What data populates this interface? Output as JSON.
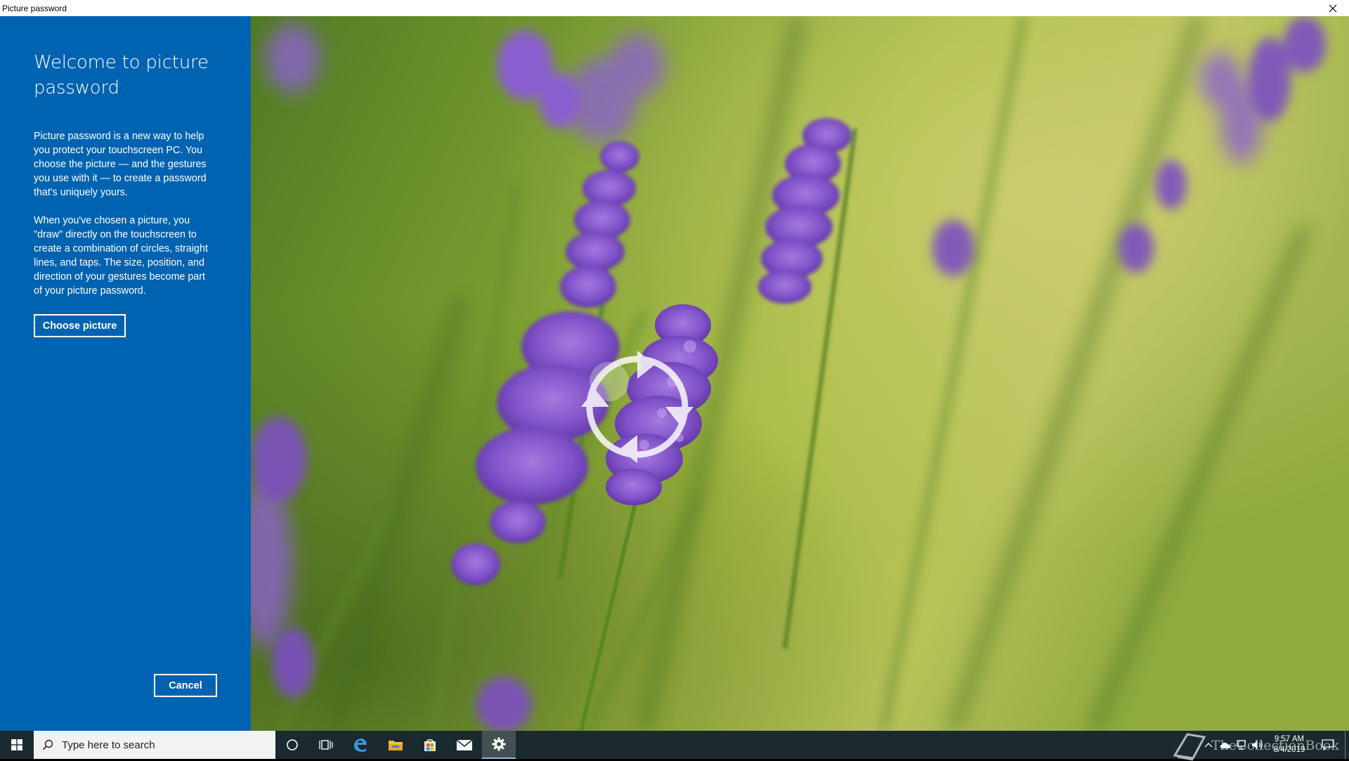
{
  "window": {
    "title": "Picture password",
    "close_icon": "close-icon"
  },
  "panel": {
    "heading": "Welcome to picture password",
    "paragraph1": "Picture password is a new way to help you protect your touchscreen PC. You choose the picture — and the gestures you use with it — to create a password that's uniquely yours.",
    "paragraph2": "When you've chosen a picture, you \"draw\" directly on the touchscreen to create a combination of circles, straight lines, and taps. The size, position, and direction of your gestures become part of your picture password.",
    "choose_label": "Choose picture",
    "cancel_label": "Cancel",
    "background_color": "#0063b1"
  },
  "picture": {
    "subject": "lavender flowers",
    "overlay_icon": "circular-gesture-icon"
  },
  "taskbar": {
    "search_placeholder": "Type here to search",
    "pinned": [
      "cortana-icon",
      "task-view-icon",
      "edge-icon",
      "file-explorer-icon",
      "store-icon",
      "mail-icon",
      "settings-icon"
    ],
    "active_app": "settings",
    "watermark": "TheCollectionBook",
    "time": "9:57 AM",
    "date": "8/4/2019",
    "background_color": "#1a2a2e"
  }
}
